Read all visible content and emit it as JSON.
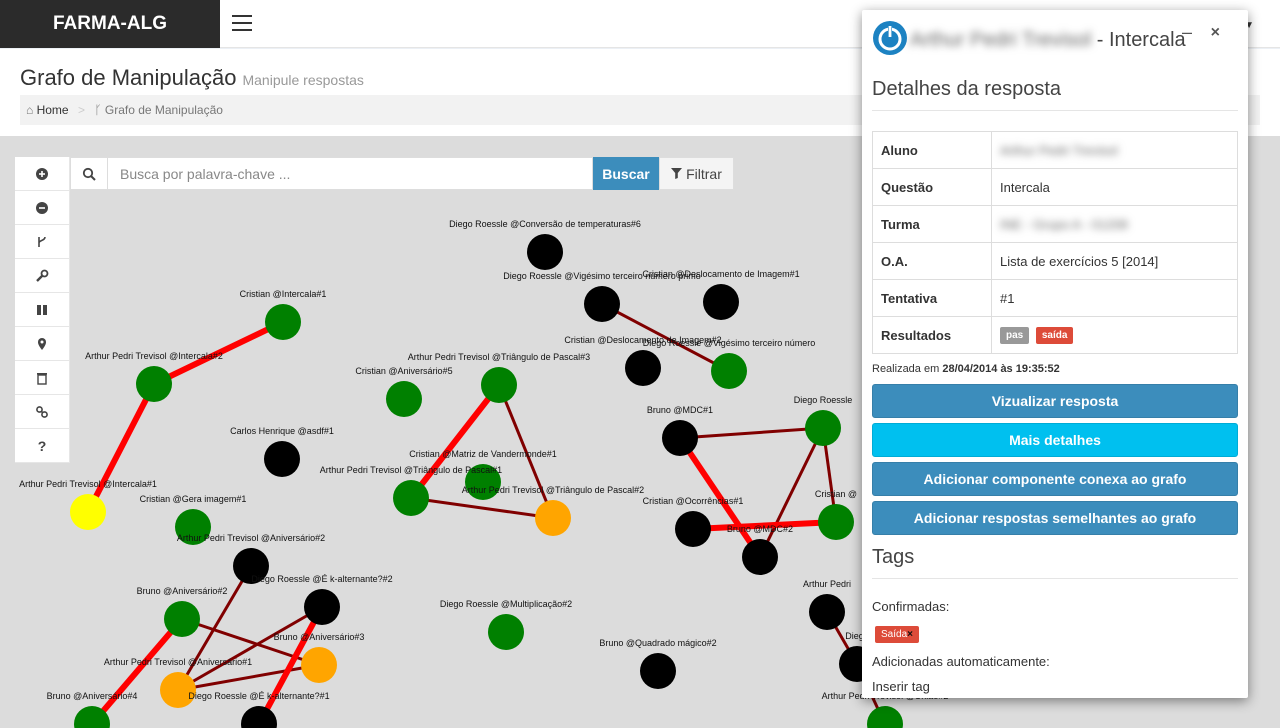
{
  "app": {
    "brand": "FARMA-ALG"
  },
  "header": {
    "title": "Grafo de Manipulação",
    "subtitle": "Manipule respostas"
  },
  "breadcrumb": {
    "home": "Home",
    "current": "Grafo de Manipulação"
  },
  "toolbar": {
    "tools": [
      {
        "name": "zoom-in-icon"
      },
      {
        "name": "zoom-out-icon"
      },
      {
        "name": "fork-icon"
      },
      {
        "name": "wrench-icon"
      },
      {
        "name": "pause-icon"
      },
      {
        "name": "map-marker-icon"
      },
      {
        "name": "trash-icon"
      },
      {
        "name": "link-icon"
      },
      {
        "name": "question-icon",
        "glyph": "?"
      }
    ]
  },
  "search": {
    "placeholder": "Busca por palavra-chave ...",
    "button": "Buscar",
    "filter": "Filtrar"
  },
  "colors": {
    "green": "#008000",
    "black": "#000000",
    "orange": "#ffa500",
    "yellow": "#ffff00",
    "edge_red": "#ff0000",
    "edge_dark": "#800000"
  },
  "graph": {
    "nodes": [
      {
        "id": 1,
        "label": "Diego Roessle @Conversão de temperaturas#6",
        "color": "black"
      },
      {
        "id": 2,
        "label": "Diego Roessle @Vigésimo terceiro número primo",
        "color": "black"
      },
      {
        "id": 3,
        "label": "Cristian @Deslocamento de Imagem#1",
        "color": "black"
      },
      {
        "id": 4,
        "label": "Cristian @Intercala#1",
        "color": "green"
      },
      {
        "id": 5,
        "label": "Arthur Pedri Trevisol @Intercala#2",
        "color": "green"
      },
      {
        "id": 6,
        "label": "Cristian @Deslocamento de Imagem#2",
        "color": "black"
      },
      {
        "id": 7,
        "label": "Diego Roessle @Vigésimo terceiro número",
        "color": "green"
      },
      {
        "id": 8,
        "label": "Cristian @Aniversário#5",
        "color": "green"
      },
      {
        "id": 9,
        "label": "Arthur Pedri Trevisol @Triângulo de Pascal#3",
        "color": "green"
      },
      {
        "id": 10,
        "label": "Bruno @MDC#1",
        "color": "black"
      },
      {
        "id": 11,
        "label": "Diego Roessle",
        "color": "green"
      },
      {
        "id": 12,
        "label": "Carlos Henrique @asdf#1",
        "color": "black"
      },
      {
        "id": 13,
        "label": "Cristian @Matriz de Vandermonde#1",
        "color": "green"
      },
      {
        "id": 14,
        "label": "Arthur Pedri Trevisol @Triângulo de Pascal#1",
        "color": "green"
      },
      {
        "id": 15,
        "label": "Arthur Pedri Trevisol @Triângulo de Pascal#2",
        "color": "orange"
      },
      {
        "id": 16,
        "label": "Arthur Pedri Trevisol @Intercala#1",
        "color": "yellow"
      },
      {
        "id": 17,
        "label": "Cristian @Gera imagem#1",
        "color": "green"
      },
      {
        "id": 18,
        "label": "Cristian @Ocorrências#1",
        "color": "black"
      },
      {
        "id": 19,
        "label": "Bruno @MDC#2",
        "color": "black"
      },
      {
        "id": 20,
        "label": "Cristian @",
        "color": "green"
      },
      {
        "id": 21,
        "label": "Arthur Pedri Trevisol @Aniversário#2",
        "color": "black"
      },
      {
        "id": 22,
        "label": "Diego Roessle @É k-alternante?#2",
        "color": "black"
      },
      {
        "id": 23,
        "label": "Bruno @Aniversário#2",
        "color": "green"
      },
      {
        "id": 24,
        "label": "Bruno @Aniversário#3",
        "color": "orange"
      },
      {
        "id": 25,
        "label": "Arthur Pedri Trevisol @Aniversário#1",
        "color": "orange"
      },
      {
        "id": 26,
        "label": "Diego Roessle @Multiplicação#2",
        "color": "green"
      },
      {
        "id": 27,
        "label": "Bruno @Quadrado mágico#2",
        "color": "black"
      },
      {
        "id": 28,
        "label": "Arthur Pedri",
        "color": "black"
      },
      {
        "id": 29,
        "label": "Diego",
        "color": "black"
      },
      {
        "id": 30,
        "label": "Bruno @Aniversário#4",
        "color": "green"
      },
      {
        "id": 31,
        "label": "Diego Roessle @É k-alternante?#1",
        "color": "black"
      },
      {
        "id": 32,
        "label": "Arthur Pedri Trevisol @União#2",
        "color": "green"
      }
    ],
    "edges": [
      {
        "from": 4,
        "to": 5,
        "color": "edge_red"
      },
      {
        "from": 5,
        "to": 16,
        "color": "edge_red"
      },
      {
        "from": 2,
        "to": 7,
        "color": "edge_dark"
      },
      {
        "from": 9,
        "to": 14,
        "color": "edge_red"
      },
      {
        "from": 9,
        "to": 15,
        "color": "edge_dark"
      },
      {
        "from": 14,
        "to": 15,
        "color": "edge_dark"
      },
      {
        "from": 10,
        "to": 11,
        "color": "edge_dark"
      },
      {
        "from": 10,
        "to": 19,
        "color": "edge_red"
      },
      {
        "from": 11,
        "to": 19,
        "color": "edge_dark"
      },
      {
        "from": 18,
        "to": 20,
        "color": "edge_red"
      },
      {
        "from": 11,
        "to": 20,
        "color": "edge_dark"
      },
      {
        "from": 21,
        "to": 25,
        "color": "edge_dark"
      },
      {
        "from": 23,
        "to": 24,
        "color": "edge_dark"
      },
      {
        "from": 22,
        "to": 25,
        "color": "edge_dark"
      },
      {
        "from": 25,
        "to": 24,
        "color": "edge_dark"
      },
      {
        "from": 23,
        "to": 30,
        "color": "edge_red"
      },
      {
        "from": 22,
        "to": 31,
        "color": "edge_red"
      },
      {
        "from": 28,
        "to": 29,
        "color": "edge_dark"
      },
      {
        "from": 29,
        "to": 32,
        "color": "edge_dark"
      }
    ]
  },
  "panel": {
    "title_name": "Arthur Pedri Trevisol",
    "title_suffix": "- Intercala",
    "section": "Detalhes da resposta",
    "rows": [
      {
        "key": "Aluno",
        "value": "Arthur Pedri Trevisol",
        "blur": true
      },
      {
        "key": "Questão",
        "value": "Intercala"
      },
      {
        "key": "Turma",
        "value": "INE - Grupo A - 01208",
        "blur": true
      },
      {
        "key": "O.A.",
        "value": "Lista de exercícios 5 [2014]"
      },
      {
        "key": "Tentativa",
        "value": "#1"
      }
    ],
    "results_key": "Resultados",
    "results": [
      {
        "label": "pas",
        "color": "#999999"
      },
      {
        "label": "saída",
        "color": "#dd4b39"
      }
    ],
    "realizada_prefix": "Realizada em",
    "realizada_date": "28/04/2014 às 19:35:52",
    "buttons": {
      "view": "Vizualizar resposta",
      "details": "Mais detalhes",
      "add_component": "Adicionar componente conexa ao grafo",
      "add_similar": "Adicionar respostas semelhantes ao grafo"
    },
    "tags_title": "Tags",
    "confirmed_label": "Confirmadas:",
    "confirmed_tag": "Saída",
    "auto_label": "Adicionadas automaticamente:",
    "insert_tag": "Inserir tag"
  }
}
